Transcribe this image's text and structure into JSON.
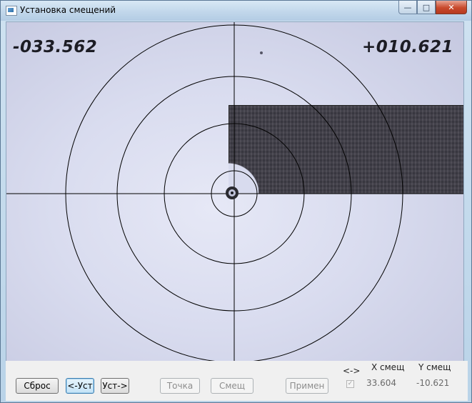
{
  "window": {
    "title": "Установка смещений",
    "minimize_glyph": "—",
    "maximize_glyph": "□",
    "close_glyph": "✕",
    "icon": "app-icon"
  },
  "viewport": {
    "x_readout": "-033.562",
    "y_readout": "+010.621",
    "crosshair_color": "#000000",
    "target_rings": 4
  },
  "toolbar": {
    "reset_label": "Сброс",
    "set_left_label": "<-Уст",
    "set_right_label": "Уст->",
    "point_label": "Точка",
    "offset_label": "Смещ",
    "apply_label": "Примен"
  },
  "offsets": {
    "swap_label": "<->",
    "x_header": "X смещ",
    "y_header": "Y смещ",
    "swap_checked": true,
    "x_value": "33.604",
    "y_value": "-10.621"
  }
}
